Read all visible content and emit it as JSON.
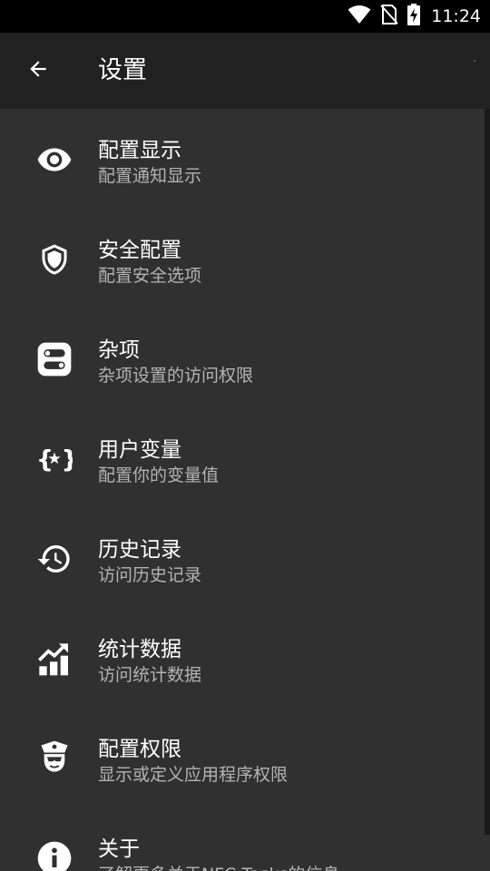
{
  "status_bar": {
    "time": "11:24",
    "icons": [
      "wifi-icon",
      "no-sim-icon",
      "battery-charging-icon"
    ]
  },
  "app_bar": {
    "title": "设置",
    "back_icon": "arrow-back-icon"
  },
  "settings": [
    {
      "icon": "eye-icon",
      "title": "配置显示",
      "subtitle": "配置通知显示"
    },
    {
      "icon": "shield-icon",
      "title": "安全配置",
      "subtitle": "配置安全选项"
    },
    {
      "icon": "toggle-switches-icon",
      "title": "杂项",
      "subtitle": "杂项设置的访问权限"
    },
    {
      "icon": "variable-braces-icon",
      "title": "用户变量",
      "subtitle": "配置你的变量值"
    },
    {
      "icon": "history-icon",
      "title": "历史记录",
      "subtitle": "访问历史记录"
    },
    {
      "icon": "chart-trending-icon",
      "title": "统计数据",
      "subtitle": "访问统计数据"
    },
    {
      "icon": "police-officer-icon",
      "title": "配置权限",
      "subtitle": "显示或定义应用程序权限"
    },
    {
      "icon": "info-icon",
      "title": "关于",
      "subtitle": "了解更多关于NFC Tasks的信息"
    }
  ],
  "colors": {
    "background": "#303030",
    "app_bar": "#212121",
    "status_bar": "#000000",
    "primary_text": "#ffffff",
    "secondary_text": "#b3b3b3"
  }
}
